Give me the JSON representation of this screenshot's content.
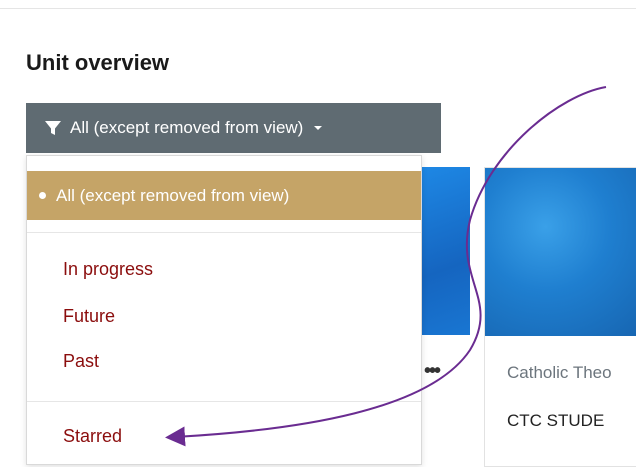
{
  "header": {
    "title": "Unit overview"
  },
  "filter": {
    "button_label": "All (except removed from view)",
    "options": [
      {
        "label": "All (except removed from view)",
        "selected": true
      },
      {
        "label": "In progress"
      },
      {
        "label": "Future"
      },
      {
        "label": "Past"
      },
      {
        "label": "Starred"
      }
    ]
  },
  "courses": [
    {
      "category": "Catholic Theo",
      "name": "CTC STUDE"
    }
  ],
  "colors": {
    "filter_button": "#5f6b72",
    "selected_option": "#c5a467",
    "menu_link": "#8b0d0d",
    "annotation_arrow": "#6a2c91"
  },
  "icons": {
    "filter": "funnel-icon",
    "caret": "caret-down-icon",
    "menu": "ellipsis-icon"
  }
}
